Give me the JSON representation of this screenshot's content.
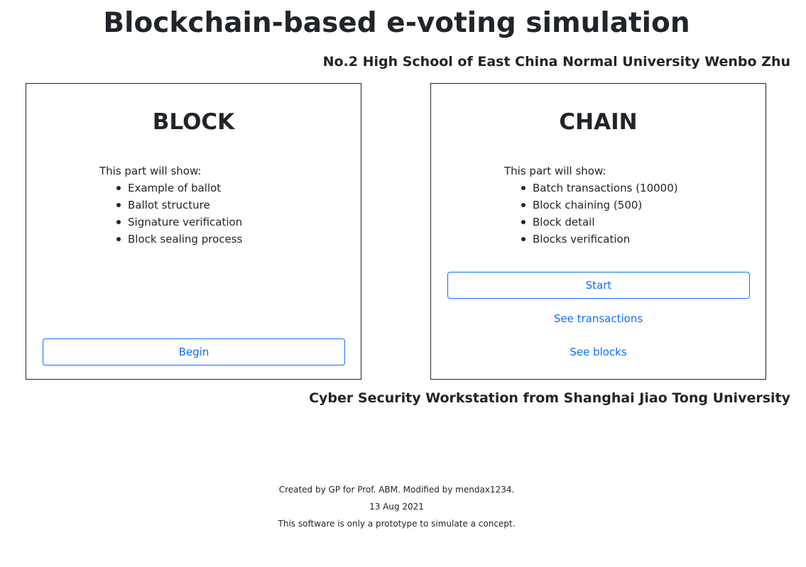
{
  "header": {
    "title": "Blockchain-based e-voting simulation",
    "author": "No.2 High School of East China Normal University Wenbo Zhu"
  },
  "block_card": {
    "heading": "BLOCK",
    "intro": "This part will show:",
    "items": [
      "Example of ballot",
      "Ballot structure",
      "Signature verification",
      "Block sealing process"
    ],
    "button_label": "Begin"
  },
  "chain_card": {
    "heading": "CHAIN",
    "intro": "This part will show:",
    "items": [
      "Batch transactions (10000)",
      "Block chaining (500)",
      "Block detail",
      "Blocks verification"
    ],
    "button_label": "Start",
    "link_transactions": "See transactions",
    "link_blocks": "See blocks"
  },
  "affiliation": "Cyber Security Workstation from Shanghai Jiao Tong University",
  "footer": {
    "credit": "Created by GP for Prof. ABM. Modified by mendax1234.",
    "date": "13 Aug 2021",
    "disclaimer": "This software is only a prototype to simulate a concept."
  },
  "colors": {
    "accent": "#0d6efd",
    "text": "#212529",
    "border": "#212529",
    "background": "#ffffff"
  }
}
